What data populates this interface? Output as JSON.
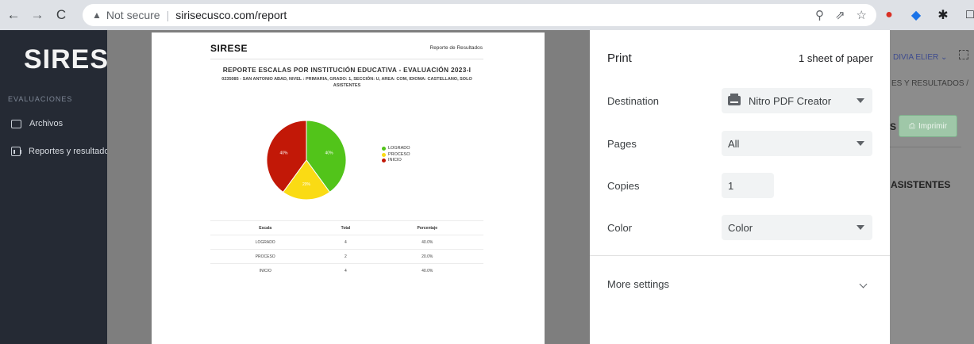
{
  "browser": {
    "security_label": "Not secure",
    "url": "sirisecusco.com/report",
    "url_display": "sirisecusco.com/report",
    "profile_initial": "M"
  },
  "sidebar": {
    "brand": "SIRES",
    "section": "EVALUACIONES",
    "items": [
      {
        "label": "Archivos",
        "icon": "folder-icon"
      },
      {
        "label": "Reportes y resultados",
        "icon": "chart-icon"
      }
    ]
  },
  "report": {
    "logo": "SIRESE",
    "header_right": "Reporte de Resultados",
    "title": "REPORTE ESCALAS POR INSTITUCIÓN EDUCATIVA - EVALUACIÓN 2023-I",
    "subtitle": "0235085 - SAN ANTONIO ABAD, NIVEL : PRIMARIA, GRADO: 1, SECCIÓN: U, AREA: COM, IDIOMA: CASTELLANO, SOLO ASISTENTES",
    "table": {
      "headers": [
        "Escala",
        "Total",
        "Porcentaje"
      ],
      "rows": [
        [
          "LOGRADO",
          "4",
          "40.0%"
        ],
        [
          "PROCESO",
          "2",
          "20.0%"
        ],
        [
          "INICIO",
          "4",
          "40.0%"
        ]
      ]
    }
  },
  "chart_data": {
    "type": "pie",
    "categories": [
      "LOGRADO",
      "PROCESO",
      "INICIO"
    ],
    "values": [
      40,
      20,
      40
    ],
    "labels": [
      "40%",
      "20%",
      "40%"
    ],
    "colors": [
      "#52c41a",
      "#fadb14",
      "#c21807"
    ],
    "legend_position": "right"
  },
  "print_dialog": {
    "title": "Print",
    "sheets": "1 sheet of paper",
    "destination_label": "Destination",
    "destination_value": "Nitro PDF Creator",
    "pages_label": "Pages",
    "pages_value": "All",
    "copies_label": "Copies",
    "copies_value": "1",
    "color_label": "Color",
    "color_value": "Color",
    "more_settings": "More settings"
  },
  "app_fragment": {
    "user": "DIVIA ELIER ⌄",
    "breadcrumb": "ES Y RESULTADOS /",
    "s_text": "S",
    "print_button": "Imprimir",
    "asistentes": "ASISTENTES"
  }
}
